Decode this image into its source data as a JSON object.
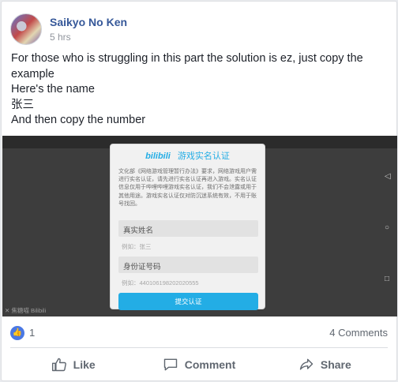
{
  "post": {
    "author": "Saikyo No Ken",
    "time": "5 hrs",
    "lines": [
      "For those who is struggling in this part the solution is ez, just copy the",
      "example",
      "Here's the name",
      "张三",
      "And then copy the number"
    ]
  },
  "media": {
    "dialog_logo": "bilibili",
    "dialog_title": "游戏实名认证",
    "dialog_desc": "文化部《网络游戏管理暂行办法》要求，网络游戏用户需进行实名认证，请先进行实名认证再进入游戏。实名认证信息仅用于哔哩哔哩游戏实名认证，我们不会泄露或用于其他用途。游戏实名认证仅对防沉迷系统有效，不用于账号找回。",
    "name_label": "真实姓名",
    "name_hint": "例如：张三",
    "id_label": "身份证号码",
    "id_hint": "例如：440106198202020555",
    "submit": "提交认证",
    "watermark": "✕ 焦糖喵 Bilibili"
  },
  "stats": {
    "likes": "1",
    "comments": "4 Comments"
  },
  "actions": {
    "like": "Like",
    "comment": "Comment",
    "share": "Share"
  },
  "colors": {
    "name_link": "#365899",
    "bilibili_blue": "#23ade5",
    "like_badge": "#4a78e4"
  }
}
